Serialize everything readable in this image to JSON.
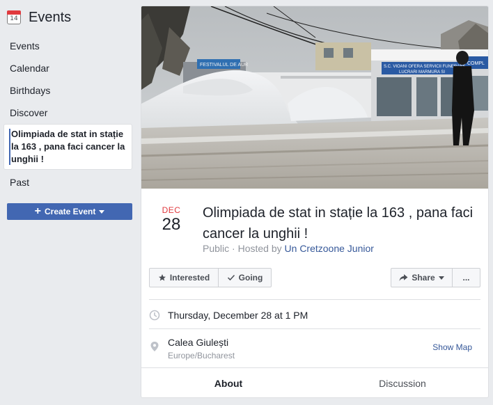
{
  "sidebar": {
    "icon_day": "14",
    "title": "Events",
    "items": [
      {
        "label": "Events"
      },
      {
        "label": "Calendar"
      },
      {
        "label": "Birthdays"
      },
      {
        "label": "Discover"
      }
    ],
    "active_event": "Olimpiada de stat in stație la 163 , pana faci cancer la unghii !",
    "past": "Past",
    "create_button": "Create Event"
  },
  "event": {
    "month": "DEC",
    "day": "28",
    "title": "Olimpiada de stat in stație la 163 , pana faci cancer la unghii !",
    "privacy": "Public",
    "hosted_prefix": "Hosted by",
    "host": "Un Cretzoone Junior",
    "cover_signs": [
      "FESTIVALUL DE AUR",
      "S.C. VIOANI OFERA SERVICII FUNERARE",
      "LUCRARI MARMURA SI",
      "COMPL"
    ]
  },
  "actions": {
    "interested": "Interested",
    "going": "Going",
    "share": "Share",
    "more": "..."
  },
  "details": {
    "datetime": "Thursday, December 28 at 1 PM",
    "location": "Calea Giulești",
    "timezone": "Europe/Bucharest",
    "show_map": "Show Map"
  },
  "tabs": {
    "about": "About",
    "discussion": "Discussion"
  },
  "colors": {
    "brand": "#4267b2",
    "link": "#365899",
    "month": "#e0393e",
    "background": "#e9ebee"
  }
}
